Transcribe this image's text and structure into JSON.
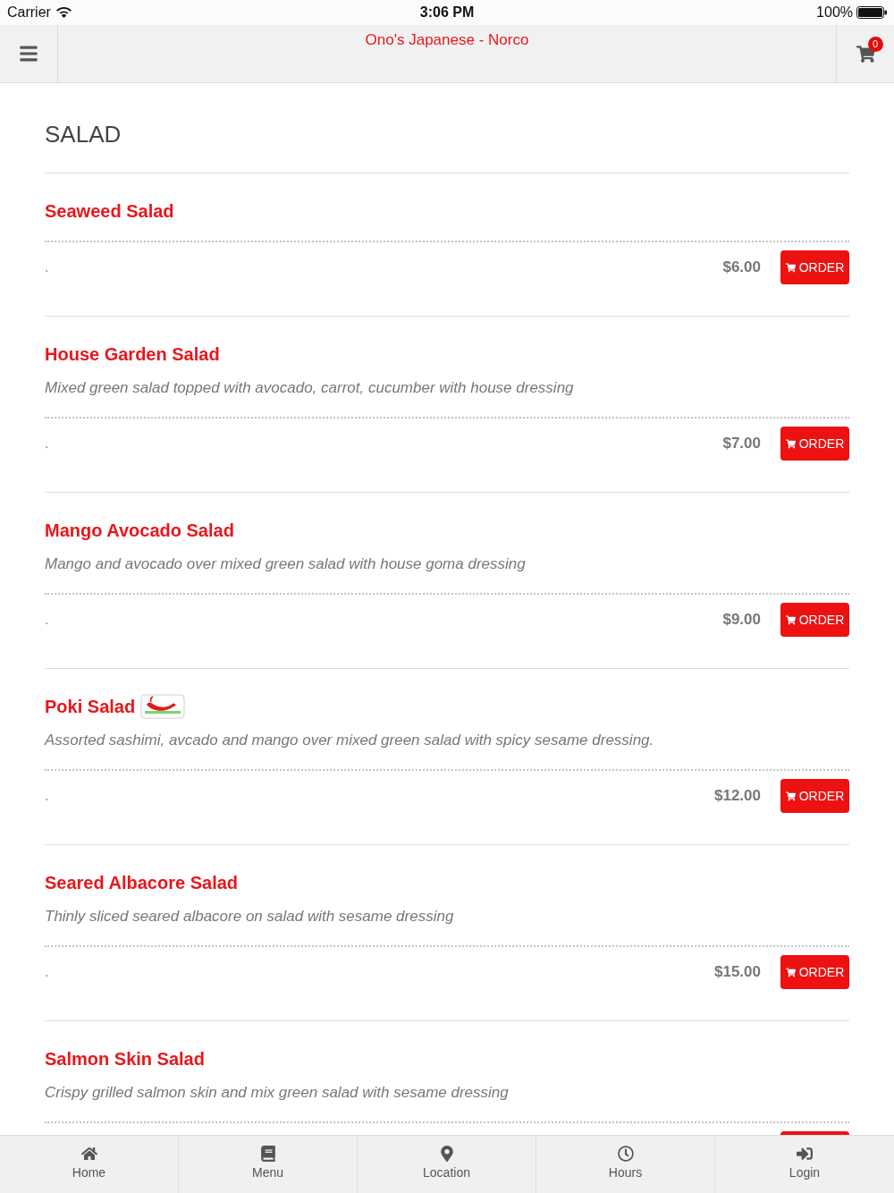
{
  "status_bar": {
    "carrier": "Carrier",
    "time": "3:06 PM",
    "battery": "100%"
  },
  "header": {
    "title": "Ono's Japanese - Norco",
    "cart_count": "0"
  },
  "section": {
    "title": "SALAD"
  },
  "items": [
    {
      "name": "Seaweed Salad",
      "spicy": false,
      "note": ".",
      "price": "$6.00",
      "button": "ORDER"
    },
    {
      "name": "House Garden Salad",
      "spicy": false,
      "description": "Mixed green salad topped with avocado, carrot, cucumber with house dressing",
      "note": ".",
      "price": "$7.00",
      "button": "ORDER"
    },
    {
      "name": "Mango Avocado Salad",
      "spicy": false,
      "description": "Mango and avocado over mixed green salad with house goma dressing",
      "note": ".",
      "price": "$9.00",
      "button": "ORDER"
    },
    {
      "name": "Poki Salad",
      "spicy": true,
      "description": "Assorted sashimi, avcado and mango over mixed green salad with spicy sesame dressing.",
      "note": ".",
      "price": "$12.00",
      "button": "ORDER"
    },
    {
      "name": "Seared Albacore Salad",
      "spicy": false,
      "description": "Thinly sliced seared albacore on salad with sesame dressing",
      "note": ".",
      "price": "$15.00",
      "button": "ORDER"
    },
    {
      "name": "Salmon Skin Salad",
      "spicy": false,
      "description": "Crispy grilled salmon skin and mix green salad with sesame dressing"
    }
  ],
  "tab_bar": [
    {
      "label": "Home",
      "selected": false
    },
    {
      "label": "Menu",
      "selected": false
    },
    {
      "label": "Location",
      "selected": false
    },
    {
      "label": "Hours",
      "selected": false
    },
    {
      "label": "Login",
      "selected": false
    }
  ]
}
